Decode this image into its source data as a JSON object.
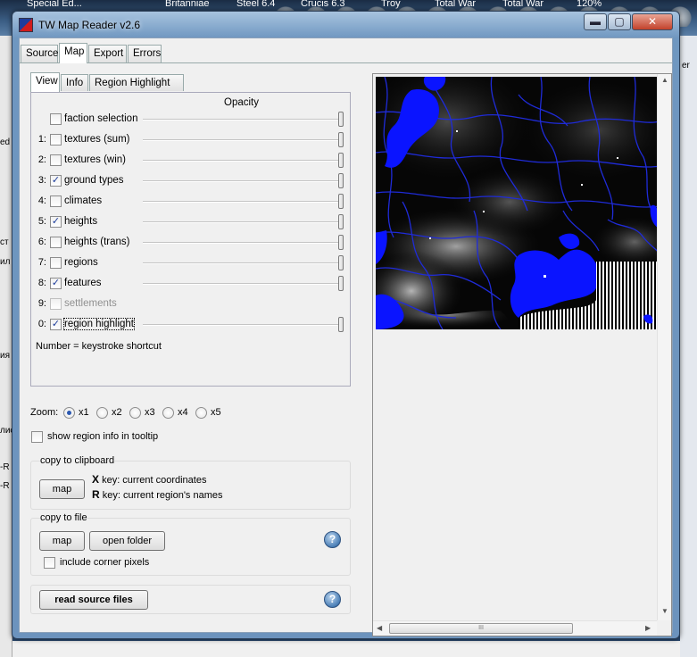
{
  "desktop": {
    "top_labels": [
      "Special Ed...",
      "Britanniae",
      "Steel 6.4",
      "Crucis 6.3",
      "Troy",
      "Total War",
      "Total War",
      "120%"
    ],
    "left_fragments": [
      "ed",
      "ст",
      "ил",
      "ия",
      "лиc",
      "-R",
      "-R"
    ],
    "right_fragments": [
      "er"
    ]
  },
  "window": {
    "title": "TW Map Reader v2.6",
    "minimize_glyph": "▬",
    "maximize_glyph": "▢",
    "close_glyph": "✕"
  },
  "main_tabs": [
    {
      "label": "Source",
      "active": false
    },
    {
      "label": "Map",
      "active": true
    },
    {
      "label": "Export",
      "active": false
    },
    {
      "label": "Errors",
      "active": false
    }
  ],
  "sub_tabs": [
    {
      "label": "View",
      "active": true
    },
    {
      "label": "Info",
      "active": false
    },
    {
      "label": "Region Highlight",
      "active": false
    }
  ],
  "layers": {
    "opacity_header": "Opacity",
    "rows": [
      {
        "num": "",
        "label": "faction selection",
        "checked": false,
        "enabled": true,
        "opacity_pct": 100
      },
      {
        "num": "1:",
        "label": "textures (sum)",
        "checked": false,
        "enabled": true,
        "opacity_pct": 100
      },
      {
        "num": "2:",
        "label": "textures (win)",
        "checked": false,
        "enabled": true,
        "opacity_pct": 100
      },
      {
        "num": "3:",
        "label": "ground types",
        "checked": true,
        "enabled": true,
        "opacity_pct": 100
      },
      {
        "num": "4:",
        "label": "climates",
        "checked": false,
        "enabled": true,
        "opacity_pct": 100
      },
      {
        "num": "5:",
        "label": "heights",
        "checked": true,
        "enabled": true,
        "opacity_pct": 100
      },
      {
        "num": "6:",
        "label": "heights (trans)",
        "checked": false,
        "enabled": true,
        "opacity_pct": 100
      },
      {
        "num": "7:",
        "label": "regions",
        "checked": false,
        "enabled": true,
        "opacity_pct": 100
      },
      {
        "num": "8:",
        "label": "features",
        "checked": true,
        "enabled": true,
        "opacity_pct": 100
      },
      {
        "num": "9:",
        "label": "settlements",
        "checked": false,
        "enabled": false,
        "opacity_pct": null
      },
      {
        "num": "0:",
        "label": "region highlight",
        "checked": true,
        "enabled": true,
        "opacity_pct": 100
      }
    ],
    "shortcut_note": "Number = keystroke shortcut"
  },
  "zoom": {
    "label": "Zoom:",
    "options": [
      "x1",
      "x2",
      "x3",
      "x4",
      "x5"
    ],
    "selected": "x1"
  },
  "tooltip_option": {
    "label": "show region info in tooltip",
    "checked": false
  },
  "clipboard": {
    "title": "copy to clipboard",
    "map_button": "map",
    "x_key": "X",
    "x_desc": "key: current coordinates",
    "r_key": "R",
    "r_desc": "key: current region's names"
  },
  "file": {
    "title": "copy to file",
    "map_button": "map",
    "open_folder_button": "open folder",
    "corner_pixels": {
      "label": "include corner pixels",
      "checked": false
    },
    "help_glyph": "?"
  },
  "read_source": {
    "button": "read source files",
    "help_glyph": "?"
  },
  "scrollbar": {
    "grip": "III",
    "up": "▲",
    "down": "▼",
    "left": "◀",
    "right": "▶"
  },
  "colors": {
    "sea": "#0a14ff",
    "region_border": "#1f2bd8",
    "window_frame": "#6f97c0"
  }
}
